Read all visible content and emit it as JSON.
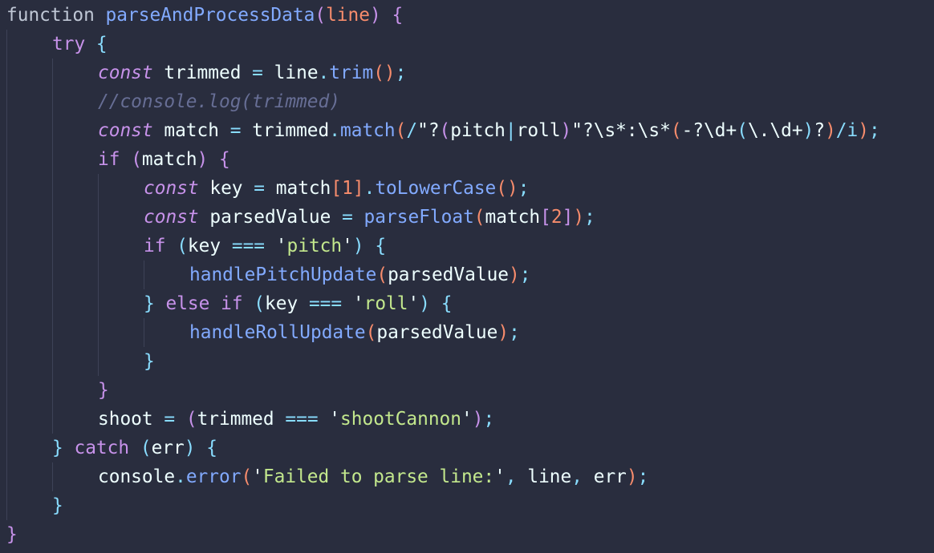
{
  "editor": {
    "language": "javascript",
    "theme_colors": {
      "background": "#292d3e",
      "default": "#bfc7d5",
      "keyword": "#c792ea",
      "function": "#82aaff",
      "string": "#c3e88d",
      "number": "#f78c6c",
      "comment": "#676e95",
      "punctuation": "#89ddff",
      "variable": "#eeffff",
      "bracket_level1": "#c792ea",
      "bracket_level2": "#89ddff",
      "bracket_level3": "#f78c6c"
    },
    "lines": [
      {
        "indent": 0,
        "tokens": [
          {
            "t": "function",
            "c": "default"
          },
          {
            "t": " ",
            "c": "default"
          },
          {
            "t": "parseAndProcessData",
            "c": "function"
          },
          {
            "t": "(",
            "c": "bracket_level1"
          },
          {
            "t": "line",
            "c": "number"
          },
          {
            "t": ")",
            "c": "bracket_level1"
          },
          {
            "t": " ",
            "c": "default"
          },
          {
            "t": "{",
            "c": "bracket_level1"
          }
        ]
      },
      {
        "indent": 1,
        "tokens": [
          {
            "t": "try",
            "c": "keyword"
          },
          {
            "t": " ",
            "c": "default"
          },
          {
            "t": "{",
            "c": "bracket_level2"
          }
        ]
      },
      {
        "indent": 2,
        "tokens": [
          {
            "t": "const",
            "c": "keyword_italic"
          },
          {
            "t": " ",
            "c": "default"
          },
          {
            "t": "trimmed",
            "c": "variable"
          },
          {
            "t": " ",
            "c": "default"
          },
          {
            "t": "=",
            "c": "punctuation"
          },
          {
            "t": " ",
            "c": "default"
          },
          {
            "t": "line",
            "c": "variable"
          },
          {
            "t": ".",
            "c": "punctuation"
          },
          {
            "t": "trim",
            "c": "function"
          },
          {
            "t": "()",
            "c": "bracket_level3"
          },
          {
            "t": ";",
            "c": "punctuation"
          }
        ]
      },
      {
        "indent": 2,
        "tokens": [
          {
            "t": "//console.log(trimmed)",
            "c": "comment"
          }
        ]
      },
      {
        "indent": 2,
        "tokens": [
          {
            "t": "const",
            "c": "keyword_italic"
          },
          {
            "t": " ",
            "c": "default"
          },
          {
            "t": "match",
            "c": "variable"
          },
          {
            "t": " ",
            "c": "default"
          },
          {
            "t": "=",
            "c": "punctuation"
          },
          {
            "t": " ",
            "c": "default"
          },
          {
            "t": "trimmed",
            "c": "variable"
          },
          {
            "t": ".",
            "c": "punctuation"
          },
          {
            "t": "match",
            "c": "function"
          },
          {
            "t": "(",
            "c": "bracket_level3"
          },
          {
            "t": "/",
            "c": "punctuation"
          },
          {
            "t": "\"?",
            "c": "variable"
          },
          {
            "t": "(",
            "c": "bracket_level1"
          },
          {
            "t": "pitch",
            "c": "variable"
          },
          {
            "t": "|",
            "c": "punctuation"
          },
          {
            "t": "roll",
            "c": "variable"
          },
          {
            "t": ")",
            "c": "bracket_level1"
          },
          {
            "t": "\"?",
            "c": "variable"
          },
          {
            "t": "\\s*",
            "c": "variable"
          },
          {
            "t": ":",
            "c": "variable"
          },
          {
            "t": "\\s*",
            "c": "variable"
          },
          {
            "t": "(",
            "c": "bracket_level3"
          },
          {
            "t": "-?",
            "c": "variable"
          },
          {
            "t": "\\d+",
            "c": "variable"
          },
          {
            "t": "(",
            "c": "bracket_level2"
          },
          {
            "t": "\\.",
            "c": "variable"
          },
          {
            "t": "\\d+",
            "c": "variable"
          },
          {
            "t": ")",
            "c": "bracket_level2"
          },
          {
            "t": "?",
            "c": "variable"
          },
          {
            "t": ")",
            "c": "bracket_level3"
          },
          {
            "t": "/i",
            "c": "punctuation"
          },
          {
            "t": ")",
            "c": "bracket_level3"
          },
          {
            "t": ";",
            "c": "punctuation"
          }
        ]
      },
      {
        "indent": 2,
        "tokens": [
          {
            "t": "if",
            "c": "keyword"
          },
          {
            "t": " ",
            "c": "default"
          },
          {
            "t": "(",
            "c": "bracket_level1"
          },
          {
            "t": "match",
            "c": "variable"
          },
          {
            "t": ")",
            "c": "bracket_level1"
          },
          {
            "t": " ",
            "c": "default"
          },
          {
            "t": "{",
            "c": "bracket_level1"
          }
        ]
      },
      {
        "indent": 3,
        "tokens": [
          {
            "t": "const",
            "c": "keyword_italic"
          },
          {
            "t": " ",
            "c": "default"
          },
          {
            "t": "key",
            "c": "variable"
          },
          {
            "t": " ",
            "c": "default"
          },
          {
            "t": "=",
            "c": "punctuation"
          },
          {
            "t": " ",
            "c": "default"
          },
          {
            "t": "match",
            "c": "variable"
          },
          {
            "t": "[",
            "c": "bracket_level3"
          },
          {
            "t": "1",
            "c": "number"
          },
          {
            "t": "]",
            "c": "bracket_level3"
          },
          {
            "t": ".",
            "c": "punctuation"
          },
          {
            "t": "toLowerCase",
            "c": "function"
          },
          {
            "t": "()",
            "c": "bracket_level3"
          },
          {
            "t": ";",
            "c": "punctuation"
          }
        ]
      },
      {
        "indent": 3,
        "tokens": [
          {
            "t": "const",
            "c": "keyword_italic"
          },
          {
            "t": " ",
            "c": "default"
          },
          {
            "t": "parsedValue",
            "c": "variable"
          },
          {
            "t": " ",
            "c": "default"
          },
          {
            "t": "=",
            "c": "punctuation"
          },
          {
            "t": " ",
            "c": "default"
          },
          {
            "t": "parseFloat",
            "c": "function"
          },
          {
            "t": "(",
            "c": "bracket_level3"
          },
          {
            "t": "match",
            "c": "variable"
          },
          {
            "t": "[",
            "c": "bracket_level1"
          },
          {
            "t": "2",
            "c": "number"
          },
          {
            "t": "]",
            "c": "bracket_level1"
          },
          {
            "t": ")",
            "c": "bracket_level3"
          },
          {
            "t": ";",
            "c": "punctuation"
          }
        ]
      },
      {
        "indent": 3,
        "tokens": [
          {
            "t": "if",
            "c": "keyword"
          },
          {
            "t": " ",
            "c": "default"
          },
          {
            "t": "(",
            "c": "bracket_level2"
          },
          {
            "t": "key",
            "c": "variable"
          },
          {
            "t": " ",
            "c": "default"
          },
          {
            "t": "===",
            "c": "punctuation"
          },
          {
            "t": " ",
            "c": "default"
          },
          {
            "t": "'",
            "c": "variable"
          },
          {
            "t": "pitch",
            "c": "string"
          },
          {
            "t": "'",
            "c": "variable"
          },
          {
            "t": ")",
            "c": "bracket_level2"
          },
          {
            "t": " ",
            "c": "default"
          },
          {
            "t": "{",
            "c": "bracket_level2"
          }
        ]
      },
      {
        "indent": 4,
        "tokens": [
          {
            "t": "handlePitchUpdate",
            "c": "function"
          },
          {
            "t": "(",
            "c": "bracket_level3"
          },
          {
            "t": "parsedValue",
            "c": "variable"
          },
          {
            "t": ")",
            "c": "bracket_level3"
          },
          {
            "t": ";",
            "c": "punctuation"
          }
        ]
      },
      {
        "indent": 3,
        "tokens": [
          {
            "t": "}",
            "c": "bracket_level2"
          },
          {
            "t": " ",
            "c": "default"
          },
          {
            "t": "else",
            "c": "keyword"
          },
          {
            "t": " ",
            "c": "default"
          },
          {
            "t": "if",
            "c": "keyword"
          },
          {
            "t": " ",
            "c": "default"
          },
          {
            "t": "(",
            "c": "bracket_level2"
          },
          {
            "t": "key",
            "c": "variable"
          },
          {
            "t": " ",
            "c": "default"
          },
          {
            "t": "===",
            "c": "punctuation"
          },
          {
            "t": " ",
            "c": "default"
          },
          {
            "t": "'",
            "c": "variable"
          },
          {
            "t": "roll",
            "c": "string"
          },
          {
            "t": "'",
            "c": "variable"
          },
          {
            "t": ")",
            "c": "bracket_level2"
          },
          {
            "t": " ",
            "c": "default"
          },
          {
            "t": "{",
            "c": "bracket_level2"
          }
        ]
      },
      {
        "indent": 4,
        "tokens": [
          {
            "t": "handleRollUpdate",
            "c": "function"
          },
          {
            "t": "(",
            "c": "bracket_level3"
          },
          {
            "t": "parsedValue",
            "c": "variable"
          },
          {
            "t": ")",
            "c": "bracket_level3"
          },
          {
            "t": ";",
            "c": "punctuation"
          }
        ]
      },
      {
        "indent": 3,
        "tokens": [
          {
            "t": "}",
            "c": "bracket_level2"
          }
        ]
      },
      {
        "indent": 2,
        "tokens": [
          {
            "t": "}",
            "c": "bracket_level1"
          }
        ]
      },
      {
        "indent": 2,
        "tokens": [
          {
            "t": "shoot",
            "c": "variable"
          },
          {
            "t": " ",
            "c": "default"
          },
          {
            "t": "=",
            "c": "punctuation"
          },
          {
            "t": " ",
            "c": "default"
          },
          {
            "t": "(",
            "c": "bracket_level1"
          },
          {
            "t": "trimmed",
            "c": "variable"
          },
          {
            "t": " ",
            "c": "default"
          },
          {
            "t": "===",
            "c": "punctuation"
          },
          {
            "t": " ",
            "c": "default"
          },
          {
            "t": "'",
            "c": "variable"
          },
          {
            "t": "shootCannon",
            "c": "string"
          },
          {
            "t": "'",
            "c": "variable"
          },
          {
            "t": ")",
            "c": "bracket_level1"
          },
          {
            "t": ";",
            "c": "punctuation"
          }
        ]
      },
      {
        "indent": 1,
        "tokens": [
          {
            "t": "}",
            "c": "bracket_level2"
          },
          {
            "t": " ",
            "c": "default"
          },
          {
            "t": "catch",
            "c": "keyword"
          },
          {
            "t": " ",
            "c": "default"
          },
          {
            "t": "(",
            "c": "bracket_level2"
          },
          {
            "t": "err",
            "c": "variable"
          },
          {
            "t": ")",
            "c": "bracket_level2"
          },
          {
            "t": " ",
            "c": "default"
          },
          {
            "t": "{",
            "c": "bracket_level2"
          }
        ]
      },
      {
        "indent": 2,
        "tokens": [
          {
            "t": "console",
            "c": "variable"
          },
          {
            "t": ".",
            "c": "punctuation"
          },
          {
            "t": "error",
            "c": "function"
          },
          {
            "t": "(",
            "c": "bracket_level3"
          },
          {
            "t": "'",
            "c": "variable"
          },
          {
            "t": "Failed to parse line:",
            "c": "string"
          },
          {
            "t": "'",
            "c": "variable"
          },
          {
            "t": ",",
            "c": "punctuation"
          },
          {
            "t": " ",
            "c": "default"
          },
          {
            "t": "line",
            "c": "variable"
          },
          {
            "t": ",",
            "c": "punctuation"
          },
          {
            "t": " ",
            "c": "default"
          },
          {
            "t": "err",
            "c": "variable"
          },
          {
            "t": ")",
            "c": "bracket_level3"
          },
          {
            "t": ";",
            "c": "punctuation"
          }
        ]
      },
      {
        "indent": 1,
        "tokens": [
          {
            "t": "}",
            "c": "bracket_level2"
          }
        ]
      },
      {
        "indent": 0,
        "tokens": [
          {
            "t": "}",
            "c": "bracket_level1"
          }
        ]
      }
    ]
  }
}
